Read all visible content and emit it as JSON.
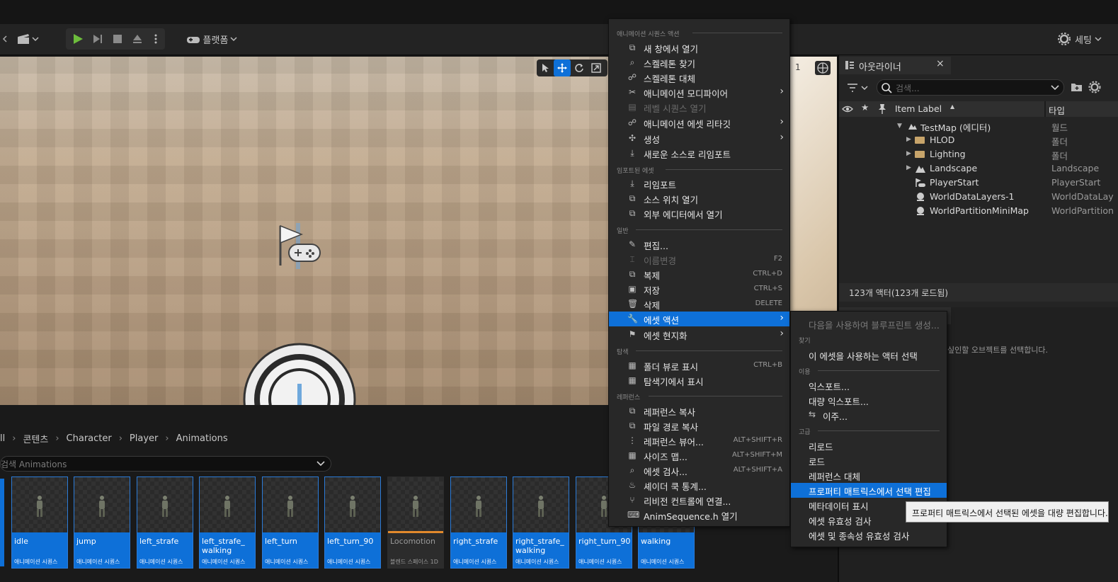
{
  "toolbar": {
    "platforms_label": "플랫폼",
    "settings_label": "세팅"
  },
  "viewport": {
    "right_count": "1"
  },
  "outliner": {
    "tab_title": "아웃라이너",
    "search_placeholder": "검색...",
    "col_label": "Item Label",
    "col_type": "타입",
    "rows": [
      {
        "label": "TestMap (에디터)",
        "type": "월드"
      },
      {
        "label": "HLOD",
        "type": "폴더"
      },
      {
        "label": "Lighting",
        "type": "폴더"
      },
      {
        "label": "Landscape",
        "type": "Landscape"
      },
      {
        "label": "PlayerStart",
        "type": "PlayerStart"
      },
      {
        "label": "WorldDataLayers-1",
        "type": "WorldDataLay"
      },
      {
        "label": "WorldPartitionMiniMap",
        "type": "WorldPartition"
      }
    ],
    "status": "123개 액터(123개 로드됨)"
  },
  "details": {
    "hint_fragment": "싶인할 오브젝트를 선택합니다."
  },
  "breadcrumb": {
    "items": [
      "ll",
      "콘텐츠",
      "Character",
      "Player",
      "Animations"
    ]
  },
  "asset_search": {
    "placeholder": "검색 Animations"
  },
  "assets": [
    {
      "name": "idle",
      "type": "애니메이션 시퀀스"
    },
    {
      "name": "jump",
      "type": "애니메이션 시퀀스"
    },
    {
      "name": "left_strafe",
      "type": "애니메이션 시퀀스"
    },
    {
      "name": "left_strafe_ walking",
      "type": "애니메이션 시퀀스"
    },
    {
      "name": "left_turn",
      "type": "애니메이션 시퀀스"
    },
    {
      "name": "left_turn_90",
      "type": "애니메이션 시퀀스"
    },
    {
      "name": "Locomotion",
      "type": "블렌드 스페이스 1D"
    },
    {
      "name": "right_strafe",
      "type": "애니메이션 시퀀스"
    },
    {
      "name": "right_strafe_ walking",
      "type": "애니메이션 시퀀스"
    },
    {
      "name": "right_turn_90",
      "type": "애니메이션 시퀀스"
    },
    {
      "name": "walking",
      "type": "애니메이션 시퀀스"
    }
  ],
  "context_menu": {
    "sections": {
      "anim": "애니메이션 시퀀스 액션",
      "imported": "임포트된 에셋",
      "common": "일반",
      "explore": "탐색",
      "references": "레퍼런스"
    },
    "items": {
      "open_new_window": "새 창에서 열기",
      "find_skeleton": "스켈레톤 찾기",
      "replace_skeleton": "스켈레톤 대체",
      "anim_modifier": "애니메이션 모디파이어",
      "open_level_sequence": "레벨 시퀀스 열기",
      "retarget": "애니메이션 에셋 리타깃",
      "create": "생성",
      "reimport_new_source": "새로운 소스로 리임포트",
      "reimport": "리임포트",
      "open_source_location": "소스 위치 열기",
      "open_external_editor": "외부 에디터에서 열기",
      "edit": "편집...",
      "rename": "이름변경",
      "rename_sc": "F2",
      "duplicate": "복제",
      "duplicate_sc": "CTRL+D",
      "save": "저장",
      "save_sc": "CTRL+S",
      "delete": "삭제",
      "delete_sc": "DELETE",
      "asset_actions": "에셋 액션",
      "asset_localization": "에셋 현지화",
      "show_in_folder_view": "폴더 뷰로 표시",
      "show_in_folder_view_sc": "CTRL+B",
      "show_in_explorer": "탐색기에서 표시",
      "copy_reference": "레퍼런스 복사",
      "copy_file_path": "파일 경로 복사",
      "reference_viewer": "레퍼런스 뷰어...",
      "reference_viewer_sc": "ALT+SHIFT+R",
      "size_map": "사이즈 맵...",
      "size_map_sc": "ALT+SHIFT+M",
      "audit_asset": "에셋 검사...",
      "audit_asset_sc": "ALT+SHIFT+A",
      "shader_cook_stats": "셰이더 쿡 통계...",
      "connect_revision_control": "리비전 컨트롤에 연결...",
      "open_header": "AnimSequence.h 열기"
    }
  },
  "submenu": {
    "sections": {
      "find": "찾기",
      "use": "이용",
      "advanced": "고급"
    },
    "items": {
      "create_blueprint": "다음을 사용하여 블루프린트 생성...",
      "select_actors": "이 에셋을 사용하는 액터 선택",
      "export": "익스포트...",
      "bulk_export": "대량 익스포트...",
      "migrate": "이주...",
      "reload": "리로드",
      "load": "로드",
      "replace_references": "레퍼런스 대체",
      "edit_property_matrix": "프로퍼티 매트릭스에서 선택 편집",
      "show_metadata": "메타데이터 표시",
      "validate_assets": "에셋 유효성 검사",
      "validate_assets_deps": "에셋 및 종속성 유효성 검사"
    }
  },
  "tooltip": {
    "text": "프로퍼티 매트릭스에서 선택된 에셋을 대량 편집합니다."
  },
  "colors": {
    "accent": "#0e70d8",
    "play_green": "#6dbd3c",
    "locomotion_bar": "#e2892c"
  }
}
